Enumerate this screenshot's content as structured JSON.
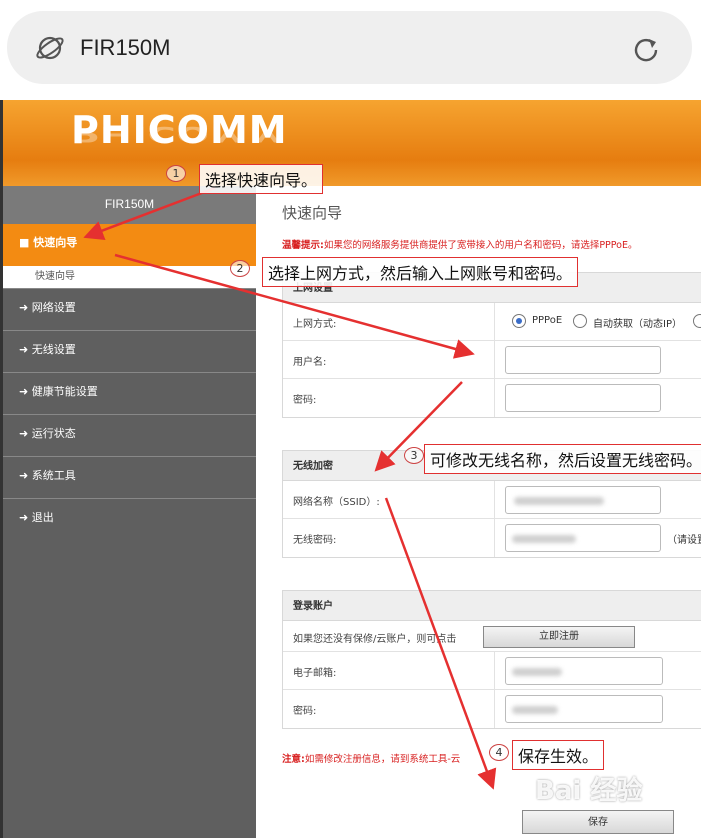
{
  "browser": {
    "url": "FIR150M"
  },
  "brand": {
    "logo": "PHICOMM",
    "model": "FIR150M"
  },
  "sidebar": {
    "active": "快速向导",
    "sub": "快速向导",
    "items": [
      {
        "label": "网络设置"
      },
      {
        "label": "无线设置"
      },
      {
        "label": "健康节能设置"
      },
      {
        "label": "运行状态"
      },
      {
        "label": "系统工具"
      },
      {
        "label": "退出"
      }
    ]
  },
  "main": {
    "title": "快速向导",
    "hint_prefix": "温馨提示:",
    "hint_text": "如果您的网络服务提供商提供了宽带接入的用户名和密码，请选择PPPoE。",
    "internet": {
      "header": "上网设置",
      "mode_label": "上网方式:",
      "options": [
        "PPPoE",
        "自动获取（动态IP）"
      ],
      "selected": "PPPoE",
      "username_label": "用户名:",
      "password_label": "密码:"
    },
    "wireless": {
      "header": "无线加密",
      "ssid_label": "网络名称（SSID）:",
      "password_label": "无线密码:",
      "password_hint": "（请设置不"
    },
    "account": {
      "header": "登录账户",
      "prompt": "如果您还没有保修/云账户，则可点击",
      "register_button": "立即注册",
      "email_label": "电子邮箱:",
      "password_label": "密码:"
    },
    "note_prefix": "注意:",
    "note_text": "如需修改注册信息，请到系统工具-云",
    "save_button": "保存"
  },
  "annotations": [
    {
      "num": "1",
      "text": "选择快速向导。"
    },
    {
      "num": "2",
      "text": "选择上网方式，然后输入上网账号和密码。"
    },
    {
      "num": "3",
      "text": "可修改无线名称，然后设置无线密码。"
    },
    {
      "num": "4",
      "text": "保存生效。"
    }
  ],
  "watermark": "Bai 经验",
  "colors": {
    "banner": "#f38b12",
    "sidebar": "#5f5f5f",
    "hint": "#d82020",
    "annotation_border": "#e03030"
  }
}
